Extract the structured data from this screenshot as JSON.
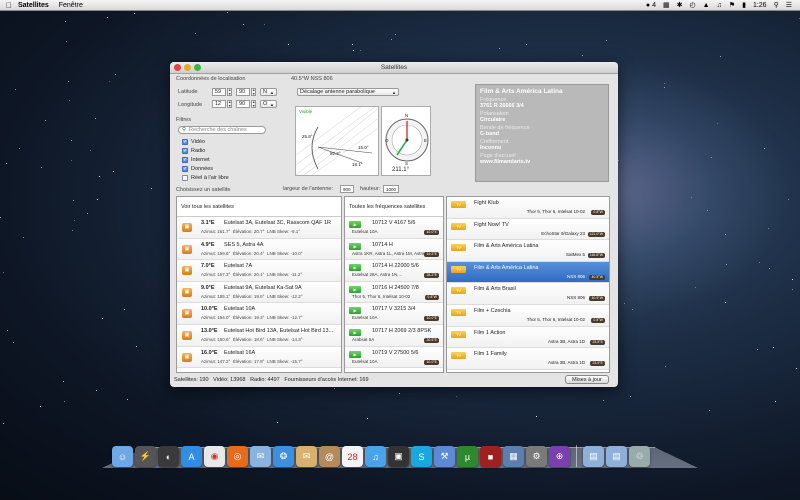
{
  "menubar": {
    "apple": "",
    "app_name": "Satellites",
    "menus": [
      "Fenêtre"
    ],
    "status_counter": "4",
    "time": "1:26"
  },
  "window": {
    "title": "Satellites",
    "location": {
      "section_label": "Coordonnées de localisation",
      "latitude_label": "Latitude",
      "latitude_deg": "59",
      "latitude_min": "90",
      "latitude_dir": "N",
      "longitude_label": "Longitude",
      "longitude_deg": "12",
      "longitude_min": "90",
      "longitude_dir": "O"
    },
    "filters": {
      "section_label": "Filtres",
      "search_placeholder": "Recherche des chaînes",
      "options": [
        {
          "label": "Vidéo",
          "checked": true
        },
        {
          "label": "Radio",
          "checked": true
        },
        {
          "label": "Internet",
          "checked": true
        },
        {
          "label": "Données",
          "checked": true
        },
        {
          "label": "Réel à l'air libre",
          "checked": false
        }
      ]
    },
    "dish": {
      "position_label": "40.5°W NSS 806",
      "mode_select": "Décalage antenne parabolique",
      "visible_label": "Visible",
      "angle_a": "25.8°",
      "angle_b": "82.3°",
      "angle_c": "15.0°",
      "angle_d": "18.1°",
      "azimuth": "211.1°",
      "compass_n": "N",
      "compass_s": "S",
      "compass_e": "E",
      "compass_w": "O",
      "antenna_width_label": "largeur de l'antenne:",
      "antenna_width": "900",
      "height_label": "hauteur:",
      "height": "1000"
    },
    "info": {
      "title": "Film & Arts América Latina",
      "freq_label": "Fréquence",
      "freq": "3761 R 26666 3/4",
      "polar_label": "Polarisation",
      "polar": "Circulaire",
      "band_label": "Bande de fréquence",
      "band": "C-band",
      "enc_label": "Chiffrement",
      "enc": "Inconnu",
      "home_label": "Page d'accueil",
      "home": "www.filmandarts.tv"
    },
    "choose_label": "Choisissez un satellite",
    "satellites_header": "Voir tous les satellites",
    "satellites": [
      {
        "deg": "3.1°E",
        "name": "Eutelsat 3A, Eutelsat 3C, Rasscom QAF 1R",
        "az": "Azimut: 161.7°",
        "el": "Élévation: 20.7°",
        "lnb": "LNB Skew: -9.1°"
      },
      {
        "deg": "4.9°E",
        "name": "SES 5, Astra 4A",
        "az": "Azimut: 159.6°",
        "el": "Élévation: 20.4°",
        "lnb": "LNB Skew: -10.0°"
      },
      {
        "deg": "7.0°E",
        "name": "Eutelsat 7A",
        "az": "Azimut: 157.3°",
        "el": "Élévation: 20.1°",
        "lnb": "LNB Skew: -11.2°"
      },
      {
        "deg": "9.0°E",
        "name": "Eutelsat 9A, Eutelsat Ka-Sat 9A",
        "az": "Azimut: 155.1°",
        "el": "Élévation: 19.5°",
        "lnb": "LNB Skew: -12.2°"
      },
      {
        "deg": "10.0°E",
        "name": "Eutelsat 10A",
        "az": "Azimut: 154.0°",
        "el": "Élévation: 19.3°",
        "lnb": "LNB Skew: -12.7°"
      },
      {
        "deg": "13.0°E",
        "name": "Eutelsat Hot Bird 13A, Eutelsat Hot Bird 13...",
        "az": "Azimut: 150.6°",
        "el": "Élévation: 18.6°",
        "lnb": "LNB Skew: -14.3°"
      },
      {
        "deg": "16.0°E",
        "name": "Eutelsat 16A",
        "az": "Azimut: 147.2°",
        "el": "Élévation: 17.8°",
        "lnb": "LNB Skew: -15.7°"
      }
    ],
    "frequencies_header": "Toutes les fréquences satellites",
    "frequencies": [
      {
        "freq": "10712 V 4167 5/6",
        "sats": "Eutelsat 10A",
        "tag": "10.0°E"
      },
      {
        "freq": "10714 H",
        "sats": "Astra 1KR, Astra 1L, Astra 1M, Astra 1N...",
        "tag": "19.2°E"
      },
      {
        "freq": "10714 H 22000 5/6",
        "sats": "Eutelsat 28A, Astra 1N,...",
        "tag": "28.2°E"
      },
      {
        "freq": "10716 H 24500 7/8",
        "sats": "Thor 5, Thor 6, Intelsat 10-02",
        "tag": "0.8°W"
      },
      {
        "freq": "10717 V 3215 3/4",
        "sats": "Eutelsat 10A",
        "tag": "10.0°E"
      },
      {
        "freq": "10717 H 2069 2/3 8PSK",
        "sats": "Arabsat 5A",
        "tag": "30.5°E"
      },
      {
        "freq": "10719 V 27500 5/6",
        "sats": "Eutelsat 10A",
        "tag": "10.0°E"
      }
    ],
    "programs": [
      {
        "name": "Fight Klub",
        "sats": "Thor 5, Thor 6, Intelsat 10-02",
        "tag": "0.8°W",
        "selected": false
      },
      {
        "name": "Fight Now! TV",
        "sats": "EchoStar 9/Galaxy 23",
        "tag": "121.0°W",
        "selected": false
      },
      {
        "name": "Film & Arts América Latina",
        "sats": "SatMex 5",
        "tag": "116.8°W",
        "selected": false
      },
      {
        "name": "Film & Arts América Latina",
        "sats": "NSS 806",
        "tag": "40.5°W",
        "selected": true
      },
      {
        "name": "Film & Arts Brasil",
        "sats": "NSS 806",
        "tag": "40.5°W",
        "selected": false
      },
      {
        "name": "Film + Czechia",
        "sats": "Thor 5, Thor 6, Intelsat 10-02",
        "tag": "0.8°W",
        "selected": false
      },
      {
        "name": "Film 1 Action",
        "sats": "Astra 3B, Astra 1D",
        "tag": "23.5°E",
        "selected": false
      },
      {
        "name": "Film 1 Family",
        "sats": "Astra 3B, Astra 1D",
        "tag": "23.5°E",
        "selected": false
      }
    ],
    "status": {
      "satellites": "Satellites: 190",
      "video": "Vidéo: 13968",
      "radio": "Radio: 4497",
      "isp": "Fournisseurs d'accès Internet: 169"
    },
    "update_button": "Mises à jour"
  },
  "colors": {
    "desktop_bg": "#13203a",
    "selected_row": "#3b76cf",
    "sat_icon": "#e08a1c",
    "freq_icon": "#3fae3b",
    "prog_icon": "#f0b52a"
  },
  "dock": {
    "icons": [
      "finder-icon",
      "launchpad-icon",
      "dashboard-icon",
      "app-store-icon",
      "chrome-icon",
      "firefox-icon",
      "mail-icon",
      "safari-icon",
      "mail-stamp-icon",
      "address-book-icon",
      "calendar-icon",
      "itunes-icon",
      "photo-icon",
      "skype-icon",
      "xcode-icon",
      "utorrent-icon",
      "photobooth-icon",
      "preview-icon",
      "system-prefs-icon",
      "satellites-icon",
      "documents-folder-icon",
      "downloads-folder-icon",
      "trash-icon"
    ],
    "calendar_day": "28"
  }
}
